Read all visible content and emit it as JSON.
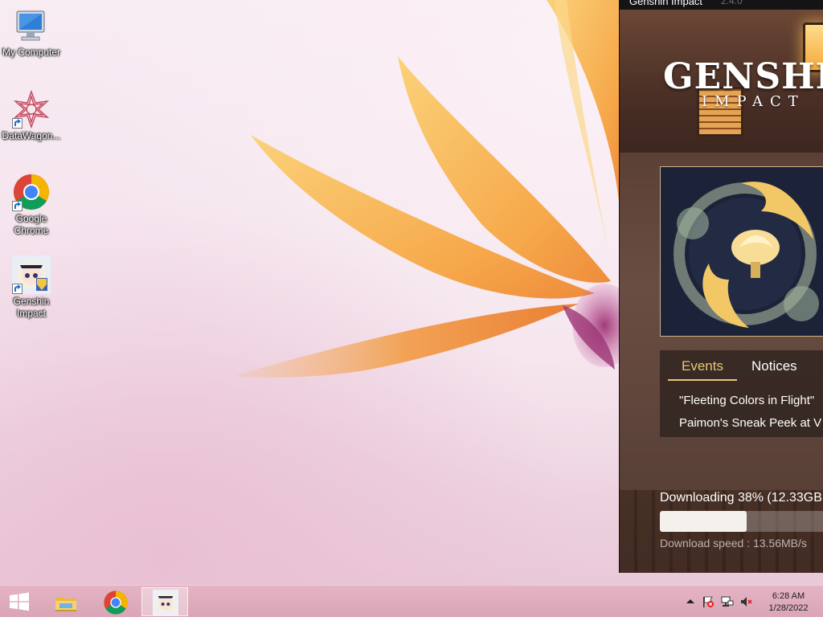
{
  "desktop": {
    "icons": [
      {
        "label": "My Computer",
        "icon": "computer-icon"
      },
      {
        "label": "DataWagon...",
        "icon": "datawagon-icon"
      },
      {
        "label": "Google Chrome",
        "icon": "chrome-icon"
      },
      {
        "label": "Genshin Impact",
        "icon": "genshin-impact-icon"
      }
    ]
  },
  "launcher": {
    "title": "Genshin Impact",
    "version": "2.4.0",
    "logo_main": "GENSHIN",
    "logo_sub": "IMPACT",
    "tabs": [
      {
        "label": "Events",
        "active": true
      },
      {
        "label": "Notices",
        "active": false
      }
    ],
    "news": [
      "\"Fleeting Colors in Flight\"",
      "Paimon's Sneak Peek at V"
    ],
    "download": {
      "status": "Downloading 38% (12.33GB",
      "progress_percent": 38,
      "speed": "Download speed :  13.56MB/s"
    }
  },
  "taskbar": {
    "pinned": [
      {
        "name": "start-button",
        "icon": "windows-logo-icon"
      },
      {
        "name": "file-explorer",
        "icon": "folder-icon"
      },
      {
        "name": "chrome",
        "icon": "chrome-icon"
      },
      {
        "name": "genshin-launcher",
        "icon": "paimon-icon",
        "active": true
      }
    ],
    "tray": {
      "icons": [
        "show-hidden-icons-arrow",
        "action-center-flag-icon",
        "network-icon",
        "volume-muted-icon"
      ],
      "time": "6:28 AM",
      "date": "1/28/2022"
    }
  },
  "colors": {
    "accent_events": "#e9c57a",
    "taskbar": "#dca9bb"
  }
}
